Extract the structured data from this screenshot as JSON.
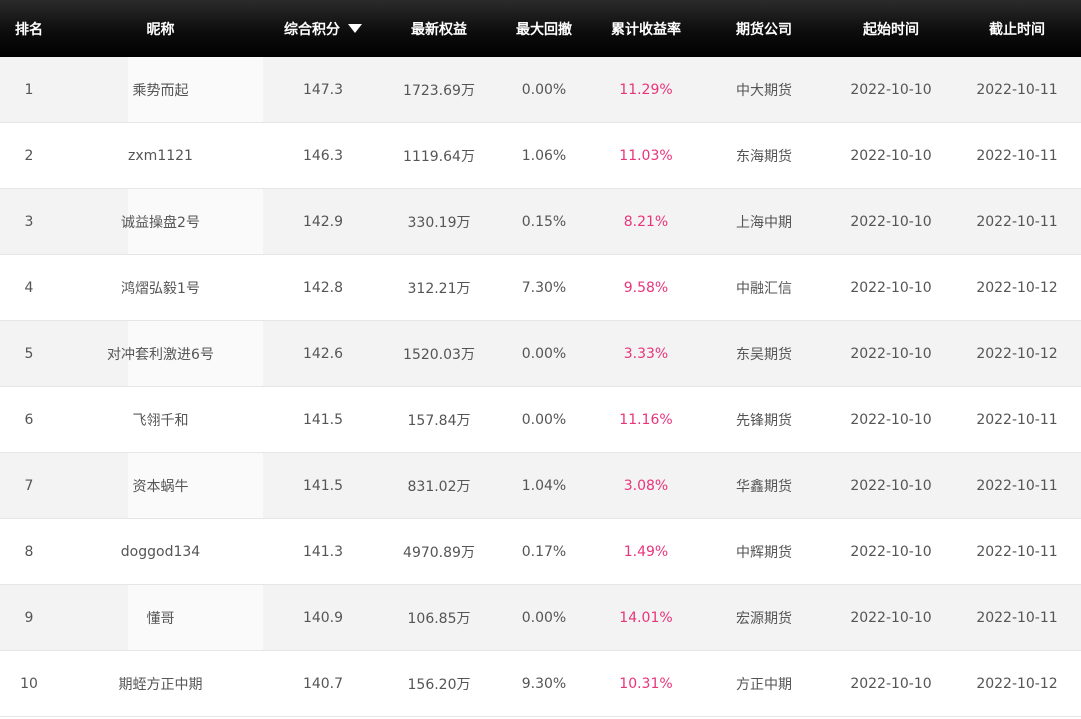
{
  "header": {
    "rank": "排名",
    "nickname": "昵称",
    "score": "综合积分",
    "equity": "最新权益",
    "drawdown": "最大回撤",
    "return_rate": "累计收益率",
    "company": "期货公司",
    "start_time": "起始时间",
    "end_time": "截止时间",
    "sort_icon": "sort-descending-icon"
  },
  "colors": {
    "header_bg": "#000000",
    "header_text": "#ffffff",
    "row_alt_bg": "#f3f3f3",
    "return_rate_text": "#e8357a",
    "body_text": "#555555"
  },
  "rows": [
    {
      "rank": "1",
      "nickname": "乘势而起",
      "score": "147.3",
      "equity": "1723.69万",
      "drawdown": "0.00%",
      "return_rate": "11.29%",
      "company": "中大期货",
      "start": "2022-10-10",
      "end": "2022-10-11"
    },
    {
      "rank": "2",
      "nickname": "zxm1121",
      "score": "146.3",
      "equity": "1119.64万",
      "drawdown": "1.06%",
      "return_rate": "11.03%",
      "company": "东海期货",
      "start": "2022-10-10",
      "end": "2022-10-11"
    },
    {
      "rank": "3",
      "nickname": "诚益操盘2号",
      "score": "142.9",
      "equity": "330.19万",
      "drawdown": "0.15%",
      "return_rate": "8.21%",
      "company": "上海中期",
      "start": "2022-10-10",
      "end": "2022-10-11"
    },
    {
      "rank": "4",
      "nickname": "鸿熠弘毅1号",
      "score": "142.8",
      "equity": "312.21万",
      "drawdown": "7.30%",
      "return_rate": "9.58%",
      "company": "中融汇信",
      "start": "2022-10-10",
      "end": "2022-10-12"
    },
    {
      "rank": "5",
      "nickname": "对冲套利激进6号",
      "score": "142.6",
      "equity": "1520.03万",
      "drawdown": "0.00%",
      "return_rate": "3.33%",
      "company": "东吴期货",
      "start": "2022-10-10",
      "end": "2022-10-12"
    },
    {
      "rank": "6",
      "nickname": "飞翎千和",
      "score": "141.5",
      "equity": "157.84万",
      "drawdown": "0.00%",
      "return_rate": "11.16%",
      "company": "先锋期货",
      "start": "2022-10-10",
      "end": "2022-10-11"
    },
    {
      "rank": "7",
      "nickname": "资本蜗牛",
      "score": "141.5",
      "equity": "831.02万",
      "drawdown": "1.04%",
      "return_rate": "3.08%",
      "company": "华鑫期货",
      "start": "2022-10-10",
      "end": "2022-10-11"
    },
    {
      "rank": "8",
      "nickname": "doggod134",
      "score": "141.3",
      "equity": "4970.89万",
      "drawdown": "0.17%",
      "return_rate": "1.49%",
      "company": "中辉期货",
      "start": "2022-10-10",
      "end": "2022-10-11"
    },
    {
      "rank": "9",
      "nickname": "懂哥",
      "score": "140.9",
      "equity": "106.85万",
      "drawdown": "0.00%",
      "return_rate": "14.01%",
      "company": "宏源期货",
      "start": "2022-10-10",
      "end": "2022-10-11"
    },
    {
      "rank": "10",
      "nickname": "期蛭方正中期",
      "score": "140.7",
      "equity": "156.20万",
      "drawdown": "9.30%",
      "return_rate": "10.31%",
      "company": "方正中期",
      "start": "2022-10-10",
      "end": "2022-10-12"
    }
  ]
}
